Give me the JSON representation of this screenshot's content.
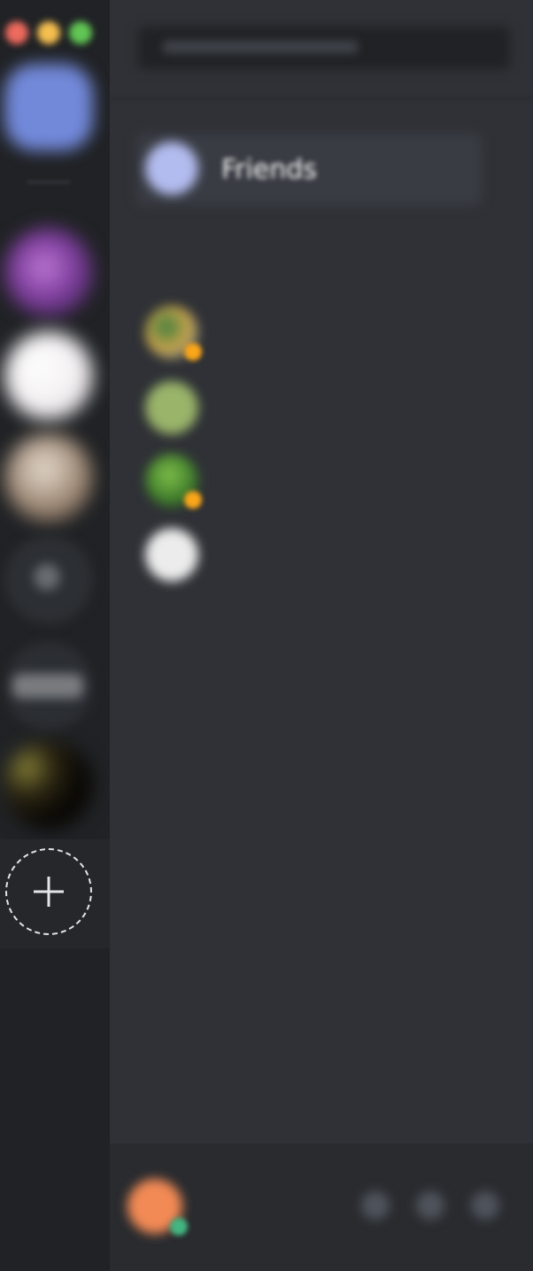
{
  "colors": {
    "rail_bg": "#202225",
    "main_bg": "#2f3136",
    "blurple": "#7289da",
    "online": "#43b581",
    "idle": "#faa61a"
  },
  "window": {
    "traffic_lights": [
      {
        "name": "close",
        "color": "#ed6a5e"
      },
      {
        "name": "minimize",
        "color": "#f5bf4f"
      },
      {
        "name": "zoom",
        "color": "#61c554"
      }
    ]
  },
  "rail": {
    "home_icon": "discord-home-icon",
    "servers": [
      {
        "icon": "server-avatar-purple"
      },
      {
        "icon": "server-avatar-white"
      },
      {
        "icon": "server-avatar-beige"
      },
      {
        "icon": "server-avatar-dark"
      },
      {
        "icon": "server-avatar-text"
      },
      {
        "icon": "server-avatar-black-gold"
      }
    ],
    "add_server_icon": "plus-icon"
  },
  "search": {
    "placeholder": ""
  },
  "friends": {
    "label": "Friends",
    "icon": "friends-icon"
  },
  "direct_messages": {
    "header": "",
    "items": [
      {
        "name": "",
        "subtitle": "",
        "status": "idle",
        "avatar_color": "#6a9a4a"
      },
      {
        "name": "",
        "subtitle": "",
        "status": "none",
        "avatar_color": "#9ab46a"
      },
      {
        "name": "",
        "subtitle": "",
        "status": "idle",
        "avatar_color": "#5d9a3a"
      },
      {
        "name": "",
        "subtitle": "",
        "status": "none",
        "avatar_color": "#e8e8e8"
      }
    ]
  },
  "user_panel": {
    "username": "",
    "tag": "",
    "status": "online",
    "controls": [
      "microphone-icon",
      "headphones-icon",
      "settings-icon"
    ]
  }
}
